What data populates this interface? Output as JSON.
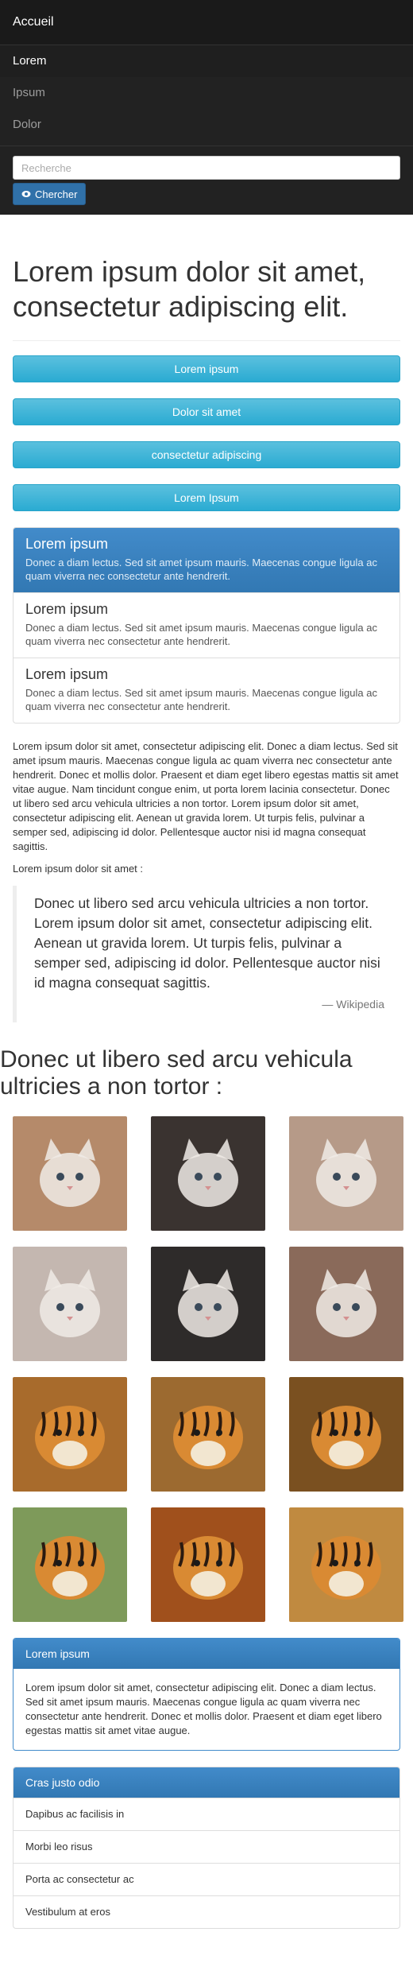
{
  "navbar": {
    "brand": "Accueil",
    "items": [
      "Lorem",
      "Ipsum",
      "Dolor"
    ],
    "search_placeholder": "Recherche",
    "search_button": "Chercher"
  },
  "hero": {
    "title": "Lorem ipsum dolor sit amet, consectetur adipiscing elit.",
    "buttons": [
      "Lorem ipsum",
      "Dolor sit amet",
      "consectetur adipiscing",
      "Lorem Ipsum"
    ]
  },
  "list_group": [
    {
      "title": "Lorem ipsum",
      "text": "Donec a diam lectus. Sed sit amet ipsum mauris. Maecenas congue ligula ac quam viverra nec consectetur ante hendrerit."
    },
    {
      "title": "Lorem ipsum",
      "text": "Donec a diam lectus. Sed sit amet ipsum mauris. Maecenas congue ligula ac quam viverra nec consectetur ante hendrerit."
    },
    {
      "title": "Lorem ipsum",
      "text": "Donec a diam lectus. Sed sit amet ipsum mauris. Maecenas congue ligula ac quam viverra nec consectetur ante hendrerit."
    }
  ],
  "body_text": {
    "paragraph": "Lorem ipsum dolor sit amet, consectetur adipiscing elit. Donec a diam lectus. Sed sit amet ipsum mauris. Maecenas congue ligula ac quam viverra nec consectetur ante hendrerit. Donec et mollis dolor. Praesent et diam eget libero egestas mattis sit amet vitae augue. Nam tincidunt congue enim, ut porta lorem lacinia consectetur. Donec ut libero sed arcu vehicula ultricies a non tortor. Lorem ipsum dolor sit amet, consectetur adipiscing elit. Aenean ut gravida lorem. Ut turpis felis, pulvinar a semper sed, adipiscing id dolor. Pellentesque auctor nisi id magna consequat sagittis.",
    "intro": "Lorem ipsum dolor sit amet :",
    "quote": "Donec ut libero sed arcu vehicula ultricies a non tortor. Lorem ipsum dolor sit amet, consectetur adipiscing elit. Aenean ut gravida lorem. Ut turpis felis, pulvinar a semper sed, adipiscing id dolor. Pellentesque auctor nisi id magna consequat sagittis.",
    "quote_source": "— Wikipedia"
  },
  "gallery": {
    "title": "Donec ut libero sed arcu vehicula ultricies a non tortor :",
    "images": [
      {
        "name": "kitten-photo",
        "bg": "#b58a6a"
      },
      {
        "name": "kitten-photo",
        "bg": "#3a3330"
      },
      {
        "name": "kitten-photo",
        "bg": "#b69a88"
      },
      {
        "name": "kitten-photo",
        "bg": "#c4b7b0"
      },
      {
        "name": "kitten-photo",
        "bg": "#2e2b2a"
      },
      {
        "name": "kitten-photo",
        "bg": "#8a6a5a"
      },
      {
        "name": "tiger-photo",
        "bg": "#a86b2c"
      },
      {
        "name": "tiger-photo",
        "bg": "#9c6a30"
      },
      {
        "name": "tiger-photo",
        "bg": "#7a5020"
      },
      {
        "name": "tiger-photo",
        "bg": "#7e9a5a"
      },
      {
        "name": "tiger-photo",
        "bg": "#a0501c"
      },
      {
        "name": "tiger-photo",
        "bg": "#c08a40"
      }
    ]
  },
  "panel_primary": {
    "heading": "Lorem ipsum",
    "body": "Lorem ipsum dolor sit amet, consectetur adipiscing elit. Donec a diam lectus. Sed sit amet ipsum mauris. Maecenas congue ligula ac quam viverra nec consectetur ante hendrerit. Donec et mollis dolor. Praesent et diam eget libero egestas mattis sit amet vitae augue."
  },
  "panel_list": {
    "heading": "Cras justo odio",
    "items": [
      "Dapibus ac facilisis in",
      "Morbi leo risus",
      "Porta ac consectetur ac",
      "Vestibulum at eros"
    ]
  }
}
